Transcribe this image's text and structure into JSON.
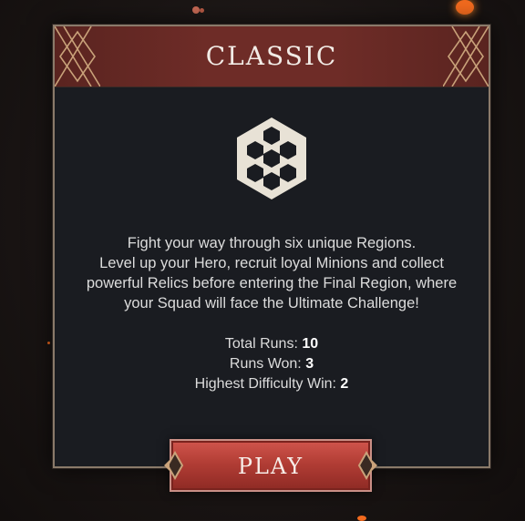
{
  "mode": {
    "title": "CLASSIC",
    "icon": "hexagon-cluster-icon",
    "description_lines": [
      "Fight your way through six unique Regions.",
      "Level up your Hero, recruit loyal Minions and collect",
      "powerful Relics before entering the Final Region, where",
      "your Squad will face the Ultimate Challenge!"
    ]
  },
  "stats": {
    "total_runs_label": "Total Runs:",
    "total_runs_value": "10",
    "runs_won_label": "Runs Won:",
    "runs_won_value": "3",
    "highest_difficulty_label": "Highest Difficulty Win:",
    "highest_difficulty_value": "2"
  },
  "play_button": {
    "label": "PLAY"
  },
  "colors": {
    "header_red": "#6e2c27",
    "panel_bg": "#1a1c21",
    "button_red": "#b23d35",
    "ember_orange": "#f26a1e"
  }
}
